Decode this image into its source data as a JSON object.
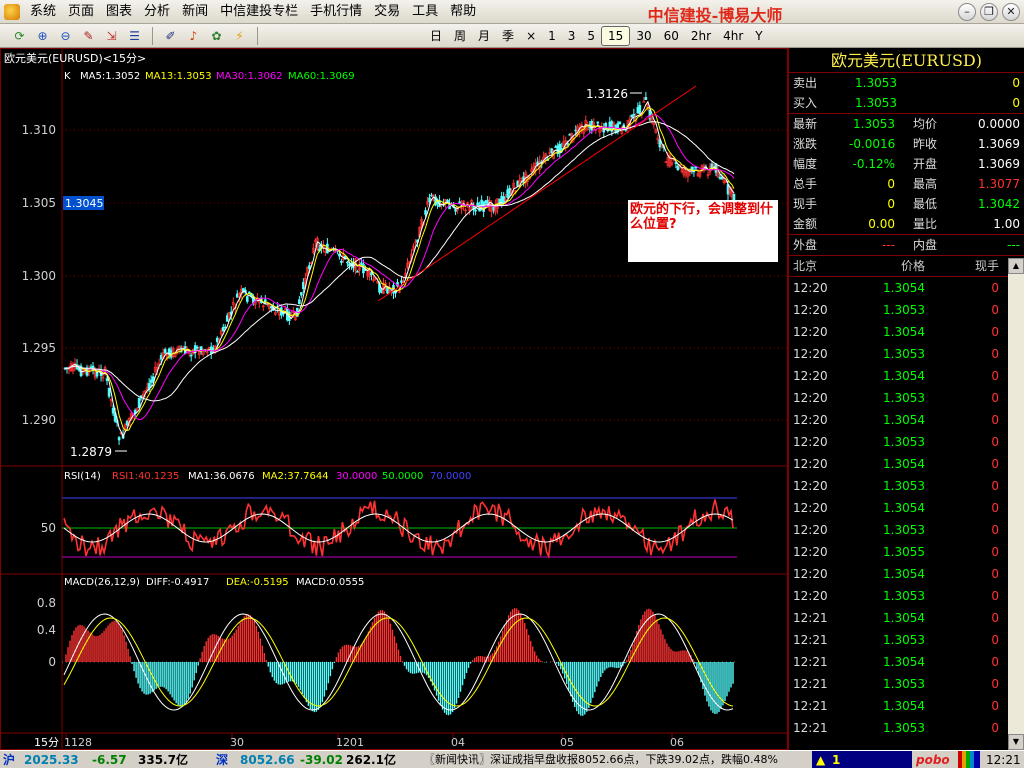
{
  "menubar": {
    "items": [
      "系统",
      "页面",
      "图表",
      "分析",
      "新闻",
      "中信建投专栏",
      "手机行情",
      "交易",
      "工具",
      "帮助"
    ],
    "brand": "中信建投-博易大师"
  },
  "toolbar": {
    "icons": [
      "refresh-icon",
      "zoom-in-icon",
      "zoom-out-icon",
      "draw-icon",
      "export-icon",
      "list-icon",
      "edit-icon",
      "alert-icon",
      "settings-icon",
      "lightning-icon"
    ],
    "periods": [
      "日",
      "周",
      "月",
      "季",
      "×",
      "1",
      "3",
      "5",
      "15",
      "30",
      "60",
      "2hr",
      "4hr",
      "Y"
    ],
    "active_period": "15"
  },
  "chart": {
    "title": "欧元美元(EURUSD)<15分>",
    "ma_legend": {
      "k": "K",
      "ma5": "MA5:1.3052",
      "ma13": "MA13:1.3053",
      "ma30": "MA30:1.3062",
      "ma60": "MA60:1.3069"
    },
    "price_ticks": [
      "1.310",
      "1.305",
      "1.300",
      "1.295",
      "1.290"
    ],
    "high_label": "1.3126",
    "low_label": "1.2879",
    "current_price_tag": "1.3045",
    "rsi_legend": {
      "name": "RSI(14)",
      "rsi1": "RSI1:40.1235",
      "ma1": "MA1:36.0676",
      "ma2": "MA2:37.7644",
      "l30": "30.0000",
      "l50": "50.0000",
      "l70": "70.0000"
    },
    "rsi_tick": "50",
    "macd_legend": {
      "name": "MACD(26,12,9)",
      "diff": "DIFF:-0.4917",
      "dea": "DEA:-0.5195",
      "macd": "MACD:0.0555"
    },
    "macd_ticks": [
      "0.8",
      "0.4",
      "0"
    ],
    "period_label": "15分",
    "x_ticks": [
      "1128",
      "30",
      "1201",
      "04",
      "05",
      "06"
    ],
    "note": "欧元的下行，会调整到什么位置?",
    "colors": {
      "up": "#ff3232",
      "down": "#54ffff",
      "ma5": "#ffffff",
      "ma13": "#ffff00",
      "ma30": "#ff00ff",
      "ma60": "#00ff00",
      "grid": "#800000",
      "trendline": "#ff0000"
    }
  },
  "quote": {
    "title": "欧元美元(EURUSD)",
    "top_rows": [
      {
        "l": "卖出",
        "v": "1.3053",
        "r": "0"
      },
      {
        "l": "买入",
        "v": "1.3053",
        "r": "0"
      }
    ],
    "stats": [
      {
        "l1": "最新",
        "v1": "1.3053",
        "c1": "#00ff00",
        "l2": "均价",
        "v2": "0.0000",
        "c2": "#ffffff"
      },
      {
        "l1": "涨跌",
        "v1": "-0.0016",
        "c1": "#00ff00",
        "l2": "昨收",
        "v2": "1.3069",
        "c2": "#ffffff"
      },
      {
        "l1": "幅度",
        "v1": "-0.12%",
        "c1": "#00ff00",
        "l2": "开盘",
        "v2": "1.3069",
        "c2": "#ffffff"
      },
      {
        "l1": "总手",
        "v1": "0",
        "c1": "#ffff00",
        "l2": "最高",
        "v2": "1.3077",
        "c2": "#ff3232"
      },
      {
        "l1": "现手",
        "v1": "0",
        "c1": "#ffff00",
        "l2": "最低",
        "v2": "1.3042",
        "c2": "#00ff00"
      },
      {
        "l1": "金额",
        "v1": "0.00",
        "c1": "#ffff00",
        "l2": "量比",
        "v2": "1.00",
        "c2": "#ffffff"
      }
    ],
    "outer": {
      "l1": "外盘",
      "v1": "---",
      "l2": "内盘",
      "v2": "---"
    },
    "ticks_header": {
      "time": "北京",
      "price": "价格",
      "vol": "现手"
    },
    "ticks": [
      {
        "t": "12:20",
        "p": "1.3054",
        "v": "0"
      },
      {
        "t": "12:20",
        "p": "1.3053",
        "v": "0"
      },
      {
        "t": "12:20",
        "p": "1.3054",
        "v": "0"
      },
      {
        "t": "12:20",
        "p": "1.3053",
        "v": "0"
      },
      {
        "t": "12:20",
        "p": "1.3054",
        "v": "0"
      },
      {
        "t": "12:20",
        "p": "1.3053",
        "v": "0"
      },
      {
        "t": "12:20",
        "p": "1.3054",
        "v": "0"
      },
      {
        "t": "12:20",
        "p": "1.3053",
        "v": "0"
      },
      {
        "t": "12:20",
        "p": "1.3054",
        "v": "0"
      },
      {
        "t": "12:20",
        "p": "1.3053",
        "v": "0"
      },
      {
        "t": "12:20",
        "p": "1.3054",
        "v": "0"
      },
      {
        "t": "12:20",
        "p": "1.3053",
        "v": "0"
      },
      {
        "t": "12:20",
        "p": "1.3055",
        "v": "0"
      },
      {
        "t": "12:20",
        "p": "1.3054",
        "v": "0"
      },
      {
        "t": "12:20",
        "p": "1.3053",
        "v": "0"
      },
      {
        "t": "12:21",
        "p": "1.3054",
        "v": "0"
      },
      {
        "t": "12:21",
        "p": "1.3053",
        "v": "0"
      },
      {
        "t": "12:21",
        "p": "1.3054",
        "v": "0"
      },
      {
        "t": "12:21",
        "p": "1.3053",
        "v": "0"
      },
      {
        "t": "12:21",
        "p": "1.3054",
        "v": "0"
      },
      {
        "t": "12:21",
        "p": "1.3053",
        "v": "0"
      }
    ]
  },
  "status": {
    "sh_label": "沪",
    "sh_index": "2025.33",
    "sh_change": "-6.57",
    "sh_amount": "335.7亿",
    "sz_label": "深",
    "sz_index": "8052.66",
    "sz_change": "-39.02",
    "sz_amount": "262.1亿",
    "news": "〖新闻快讯〗深证成指早盘收报8052.66点，下跌39.02点，跌幅0.48%",
    "alert_count": "1",
    "pobo": "pobo",
    "time": "12:21"
  }
}
